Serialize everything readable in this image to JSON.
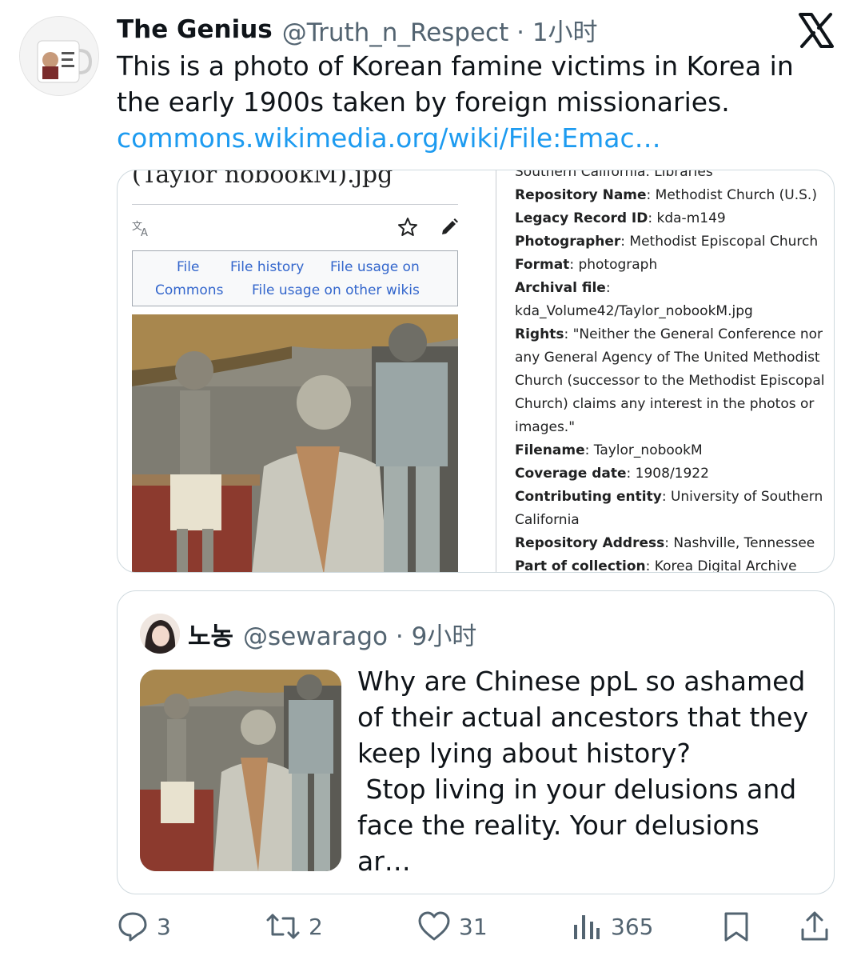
{
  "tweet": {
    "display_name": "The Genius",
    "handle_time": "@Truth_n_Respect · 1小时",
    "text": "This is a photo of Korean famine victims in Korea in the early 1900s  taken by foreign missionaries.",
    "link": "commons.wikimedia.org/wiki/File:Emac…"
  },
  "wiki": {
    "title_clipped": "(Taylor nobookM).jpg",
    "tabs": [
      "File",
      "File history",
      "File usage on",
      "Commons",
      "File usage on other wikis"
    ],
    "metadata_top_clipped": "Southern California. Libraries",
    "metadata": [
      {
        "label": "Repository Name",
        "value": ": Methodist Church (U.S.)"
      },
      {
        "label": "Legacy Record ID",
        "value": ": kda-m149"
      },
      {
        "label": "Photographer",
        "value": ": Methodist Episcopal Church"
      },
      {
        "label": "Format",
        "value": ": photograph"
      },
      {
        "label": "Archival file",
        "value": ":"
      },
      {
        "label": "",
        "value": "kda_Volume42/Taylor_nobookM.jpg"
      },
      {
        "label": "Rights",
        "value": ": \"Neither the General Conference nor any General Agency of The United Methodist Church (successor to the Methodist Episcopal Church) claims any interest in the photos or images.\""
      },
      {
        "label": "Filename",
        "value": ": Taylor_nobookM"
      },
      {
        "label": "Coverage date",
        "value": ": 1908/1922"
      },
      {
        "label": "Contributing entity",
        "value": ": University of Southern California"
      },
      {
        "label": "Repository Address",
        "value": ": Nashville, Tennessee"
      },
      {
        "label": "Part of collection",
        "value": ": Korea Digital Archive"
      }
    ]
  },
  "quote": {
    "display_name": "노농",
    "handle_time": "@sewarago · 9小时",
    "text": "Why are Chinese ppL so ashamed of their actual ancestors that they keep lying about history?\n Stop living in your delusions and face the reality. Your delusions ar…"
  },
  "actions": {
    "replies": "3",
    "reposts": "2",
    "likes": "31",
    "views": "365"
  },
  "icons": [
    "x-logo-icon",
    "translate-icon",
    "star-icon",
    "pencil-icon",
    "reply-icon",
    "repost-icon",
    "like-icon",
    "views-icon",
    "bookmark-icon",
    "share-icon"
  ]
}
